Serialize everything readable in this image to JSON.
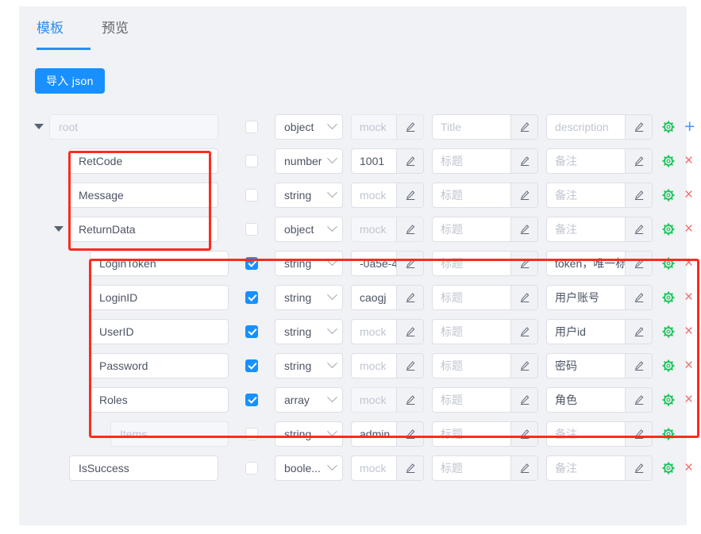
{
  "tabs": [
    {
      "label": "模板",
      "active": true
    },
    {
      "label": "预览",
      "active": false
    }
  ],
  "toolbar": {
    "import_json_label": "导入 json"
  },
  "columns": {
    "mock_placeholder": "mock",
    "title_placeholder_root": "Title",
    "desc_placeholder_root": "description",
    "title_placeholder": "标题",
    "desc_placeholder": "备注"
  },
  "icons": {
    "pencil": "pencil-icon",
    "gear": "gear-icon",
    "remove": "×",
    "add": "+",
    "caret": "caret-down-icon",
    "chevron": "chevron-down-icon"
  },
  "colors": {
    "accent": "#1890ff",
    "gear": "#22c55e",
    "remove": "#f56c6c",
    "add": "#409eff",
    "annotation": "#fb2c1e",
    "panel_bg": "#f0f2f5"
  },
  "rows": [
    {
      "name": "root",
      "name_disabled": true,
      "indent": 0,
      "caret": true,
      "checked": false,
      "type": "object",
      "mock": "mock",
      "mock_is_placeholder": true,
      "mock_disabled": true,
      "title": "Title",
      "title_is_placeholder": true,
      "desc": "description",
      "desc_is_placeholder": true,
      "has_remove": false,
      "has_add": true
    },
    {
      "name": "RetCode",
      "name_disabled": false,
      "indent": 1,
      "caret": false,
      "checked": false,
      "type": "number",
      "mock": "1001",
      "mock_is_placeholder": false,
      "mock_disabled": false,
      "title": "标题",
      "title_is_placeholder": true,
      "desc": "备注",
      "desc_is_placeholder": true,
      "has_remove": true,
      "has_add": true
    },
    {
      "name": "Message",
      "name_disabled": false,
      "indent": 1,
      "caret": false,
      "checked": false,
      "type": "string",
      "mock": "mock",
      "mock_is_placeholder": true,
      "mock_disabled": false,
      "title": "标题",
      "title_is_placeholder": true,
      "desc": "备注",
      "desc_is_placeholder": true,
      "has_remove": true,
      "has_add": true
    },
    {
      "name": "ReturnData",
      "name_disabled": false,
      "indent": 1,
      "caret": true,
      "checked": false,
      "type": "object",
      "mock": "mock",
      "mock_is_placeholder": true,
      "mock_disabled": true,
      "title": "标题",
      "title_is_placeholder": true,
      "desc": "备注",
      "desc_is_placeholder": true,
      "has_remove": true,
      "has_add": true
    },
    {
      "name": "LoginToken",
      "name_disabled": false,
      "indent": 2,
      "caret": false,
      "checked": true,
      "type": "string",
      "mock": "-0a5e-4",
      "mock_is_placeholder": false,
      "mock_disabled": false,
      "title": "标题",
      "title_is_placeholder": true,
      "desc": "token，唯一标",
      "desc_is_placeholder": false,
      "has_remove": true,
      "has_add": true
    },
    {
      "name": "LoginID",
      "name_disabled": false,
      "indent": 2,
      "caret": false,
      "checked": true,
      "type": "string",
      "mock": "caogj",
      "mock_is_placeholder": false,
      "mock_disabled": false,
      "title": "标题",
      "title_is_placeholder": true,
      "desc": "用户账号",
      "desc_is_placeholder": false,
      "has_remove": true,
      "has_add": true
    },
    {
      "name": "UserID",
      "name_disabled": false,
      "indent": 2,
      "caret": false,
      "checked": true,
      "type": "string",
      "mock": "mock",
      "mock_is_placeholder": true,
      "mock_disabled": false,
      "title": "标题",
      "title_is_placeholder": true,
      "desc": "用户id",
      "desc_is_placeholder": false,
      "has_remove": true,
      "has_add": true
    },
    {
      "name": "Password",
      "name_disabled": false,
      "indent": 2,
      "caret": false,
      "checked": true,
      "type": "string",
      "mock": "mock",
      "mock_is_placeholder": true,
      "mock_disabled": false,
      "title": "标题",
      "title_is_placeholder": true,
      "desc": "密码",
      "desc_is_placeholder": false,
      "has_remove": true,
      "has_add": true
    },
    {
      "name": "Roles",
      "name_disabled": false,
      "indent": 2,
      "caret": false,
      "checked": true,
      "type": "array",
      "mock": "mock",
      "mock_is_placeholder": true,
      "mock_disabled": true,
      "title": "标题",
      "title_is_placeholder": true,
      "desc": "角色",
      "desc_is_placeholder": false,
      "has_remove": true,
      "has_add": true
    },
    {
      "name": "Items",
      "name_disabled": true,
      "indent": 3,
      "caret": false,
      "checked": false,
      "type": "string",
      "mock": "admin",
      "mock_is_placeholder": false,
      "mock_disabled": false,
      "title": "标题",
      "title_is_placeholder": true,
      "desc": "备注",
      "desc_is_placeholder": true,
      "has_remove": false,
      "has_add": false
    },
    {
      "name": "IsSuccess",
      "name_disabled": false,
      "indent": 1,
      "caret": false,
      "checked": false,
      "type": "boole...",
      "mock": "mock",
      "mock_is_placeholder": true,
      "mock_disabled": false,
      "title": "标题",
      "title_is_placeholder": true,
      "desc": "备注",
      "desc_is_placeholder": true,
      "has_remove": true,
      "has_add": true
    }
  ],
  "annotations": [
    {
      "name": "highlight-top-fields"
    },
    {
      "name": "highlight-returndata-children"
    }
  ]
}
